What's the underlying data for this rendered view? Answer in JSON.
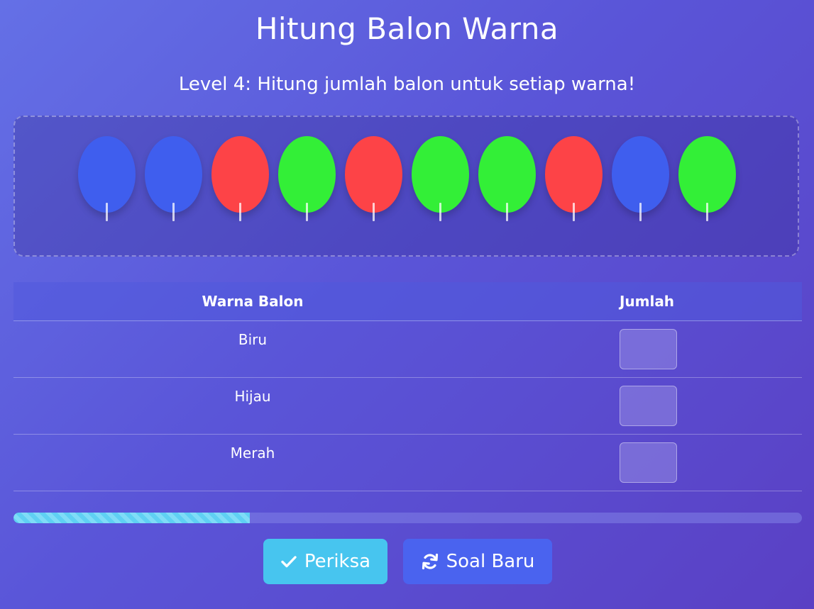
{
  "title": "Hitung Balon Warna",
  "subtitle": "Level 4: Hitung jumlah balon untuk setiap warna!",
  "colors": {
    "blue": "#3f5eee",
    "red": "#fd4347",
    "green": "#33ef37",
    "check_button": "#47c5ef",
    "new_button": "#4a63ef"
  },
  "balloons": [
    "blue",
    "blue",
    "red",
    "green",
    "red",
    "green",
    "green",
    "red",
    "blue",
    "green"
  ],
  "table": {
    "header_color": "Warna Balon",
    "header_count": "Jumlah",
    "rows": [
      {
        "label": "Biru",
        "value": ""
      },
      {
        "label": "Hijau",
        "value": ""
      },
      {
        "label": "Merah",
        "value": ""
      }
    ]
  },
  "progress": 0.3,
  "buttons": {
    "check_label": "Periksa",
    "check_icon": "check-icon",
    "new_label": "Soal Baru",
    "new_icon": "refresh-icon"
  }
}
